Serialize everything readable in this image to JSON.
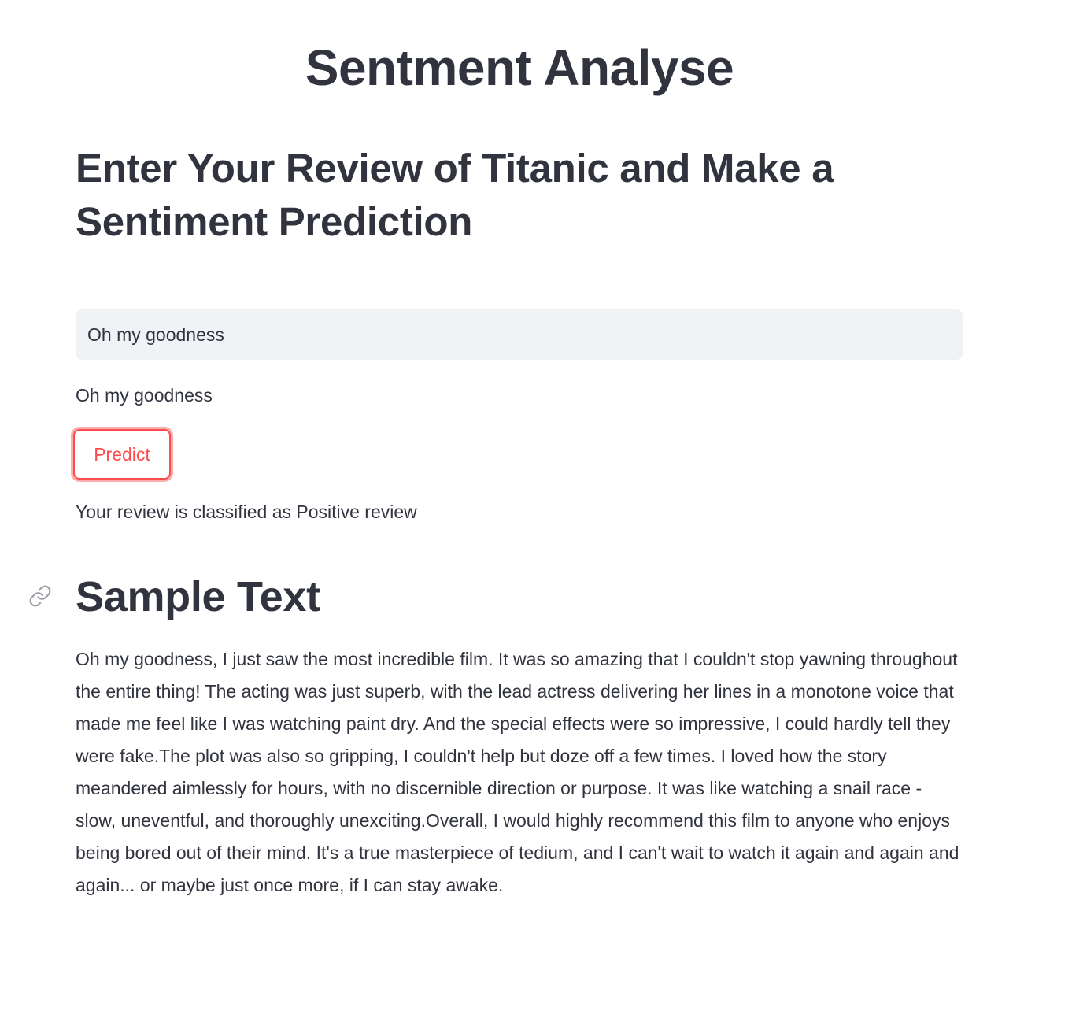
{
  "header": {
    "title": "Sentment Analyse"
  },
  "main": {
    "subheader": "Enter Your Review of Titanic and Make a Sentiment Prediction",
    "review_input": {
      "value": "Oh my goodness",
      "placeholder": ""
    },
    "echo_text": "Oh my goodness",
    "predict_button_label": "Predict",
    "result_text": "Your review is classified as Positive review",
    "sample_section": {
      "heading": "Sample Text",
      "anchor_icon": "link-icon",
      "paragraph": "Oh my goodness, I just saw the most incredible film. It was so amazing that I couldn't stop yawning throughout the entire thing! The acting was just superb, with the lead actress delivering her lines in a monotone voice that made me feel like I was watching paint dry. And the special effects were so impressive, I could hardly tell they were fake.The plot was also so gripping, I couldn't help but doze off a few times. I loved how the story meandered aimlessly for hours, with no discernible direction or purpose. It was like watching a snail race - slow, uneventful, and thoroughly unexciting.Overall, I would highly recommend this film to anyone who enjoys being bored out of their mind. It's a true masterpiece of tedium, and I can't wait to watch it again and again and again... or maybe just once more, if I can stay awake."
    }
  },
  "colors": {
    "text": "#31333f",
    "accent": "#ff4b4b",
    "input_background": "#f0f2f6",
    "page_background": "#ffffff"
  }
}
